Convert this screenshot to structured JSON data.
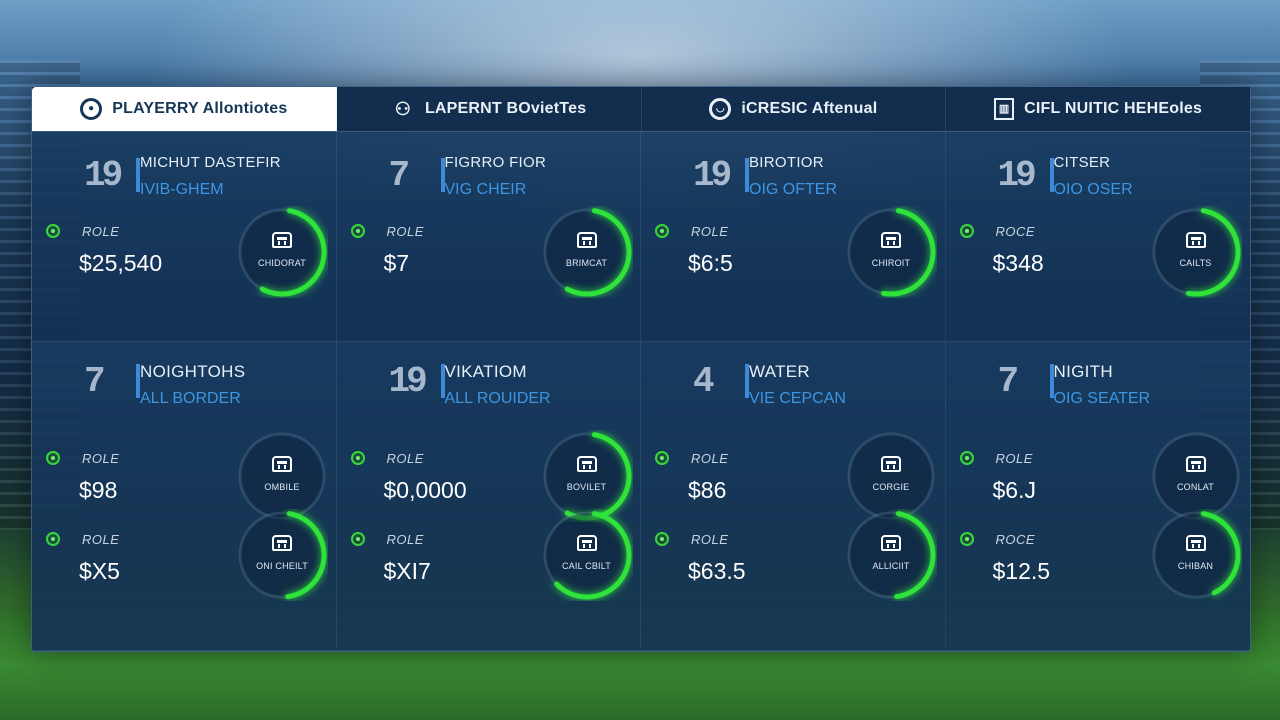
{
  "tabs": [
    {
      "label": "PLAYERRY Allontiotes",
      "icon": "circle-badge-icon",
      "active": true
    },
    {
      "label": "LAPERNT BOvietTes",
      "icon": "binoculars-icon",
      "active": false
    },
    {
      "label": "iCRESIC Aftenual",
      "icon": "ball-icon",
      "active": false
    },
    {
      "label": "CIFL NUITIC HEHEoles",
      "icon": "stadium-icon",
      "active": false
    }
  ],
  "cards_top": [
    {
      "jersey": "19",
      "name": "MICHUT DASTEFIR",
      "role": "IVIB-GHEM",
      "stat_label": "ROLE",
      "stat_value": "$25,540",
      "ring_caption": "CHIDORAT",
      "ring_fraction": 0.55
    },
    {
      "jersey": "7",
      "name": "FIGRRO FIOR",
      "role": "VIG CHEIR",
      "stat_label": "ROLE",
      "stat_value": "$7",
      "ring_caption": "BRIMCAT",
      "ring_fraction": 0.55
    },
    {
      "jersey": "19",
      "name": "BIROTIOR",
      "role": "OIG OFTER",
      "stat_label": "ROLE",
      "stat_value": "$6:5",
      "ring_caption": "CHIROIT",
      "ring_fraction": 0.5
    },
    {
      "jersey": "19",
      "name": "CITSER",
      "role": "OIO OSER",
      "stat_label": "ROCE",
      "stat_value": "$348",
      "ring_caption": "CAILTS",
      "ring_fraction": 0.5
    }
  ],
  "cards_bottom": [
    {
      "jersey": "7",
      "name": "NOIGHTOHS",
      "role": "ALL BORDER",
      "stats": [
        {
          "label": "ROLE",
          "value": "$98",
          "ring_caption": "OMBILE",
          "ring_fraction": 0.0
        },
        {
          "label": "ROLE",
          "value": "$X5",
          "ring_caption": "ONI CHEILT",
          "ring_fraction": 0.45
        }
      ]
    },
    {
      "jersey": "19",
      "name": "VIKATIOM",
      "role": "ALL ROUIDER",
      "stats": [
        {
          "label": "ROLE",
          "value": "$0,0000",
          "ring_caption": "BOVILET",
          "ring_fraction": 0.55
        },
        {
          "label": "ROLE",
          "value": "$XI7",
          "ring_caption": "CAIL CBILT",
          "ring_fraction": 0.6
        }
      ]
    },
    {
      "jersey": "4",
      "name": "WATER",
      "role": "VIE CEPCAN",
      "stats": [
        {
          "label": "ROLE",
          "value": "$86",
          "ring_caption": "CORGIE",
          "ring_fraction": 0.0
        },
        {
          "label": "ROLE",
          "value": "$63.5",
          "ring_caption": "ALLICIIT",
          "ring_fraction": 0.45
        }
      ]
    },
    {
      "jersey": "7",
      "name": "NIGITH",
      "role": "OIG SEATER",
      "stats": [
        {
          "label": "ROLE",
          "value": "$6.J",
          "ring_caption": "CONLAT",
          "ring_fraction": 0.0
        },
        {
          "label": "ROCE",
          "value": "$12.5",
          "ring_caption": "CHIBAN",
          "ring_fraction": 0.4
        }
      ]
    }
  ],
  "colors": {
    "accent_green": "#2fe33a",
    "accent_blue": "#3e95e2",
    "panel": "#143458"
  }
}
